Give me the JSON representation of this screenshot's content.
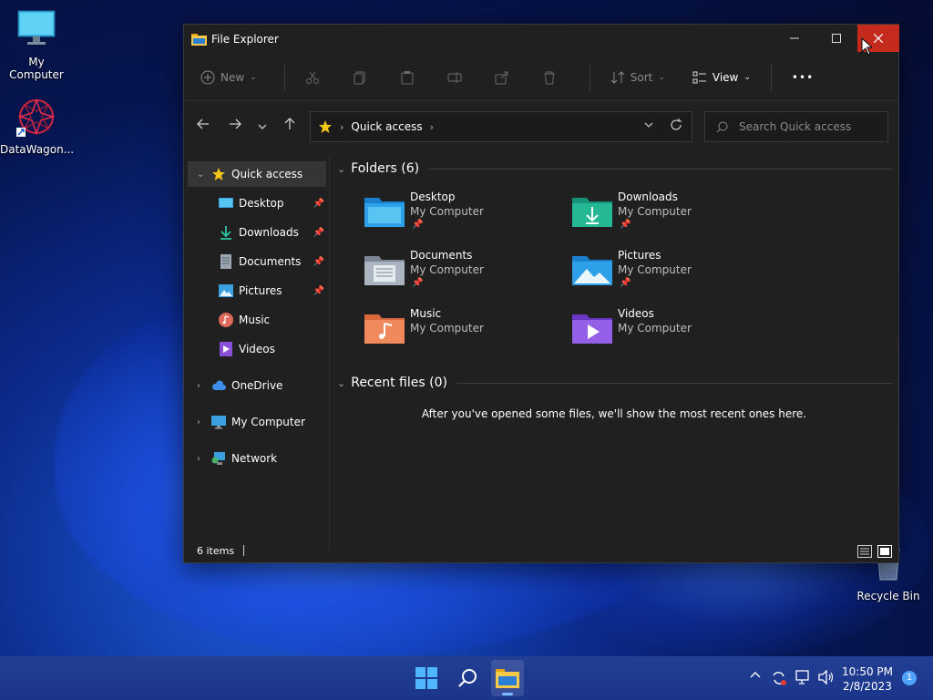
{
  "desktop": {
    "icons": [
      {
        "label": "My Computer"
      },
      {
        "label": "DataWagon..."
      },
      {
        "label": "Recycle Bin"
      }
    ]
  },
  "window": {
    "title": "File Explorer",
    "toolbar": {
      "new_label": "New",
      "sort_label": "Sort",
      "view_label": "View",
      "more_label": "•••"
    },
    "address": {
      "crumb": "Quick access",
      "search_placeholder": "Search Quick access"
    },
    "nav": {
      "quick_access": "Quick access",
      "items": [
        {
          "label": "Desktop",
          "pinned": true
        },
        {
          "label": "Downloads",
          "pinned": true
        },
        {
          "label": "Documents",
          "pinned": true
        },
        {
          "label": "Pictures",
          "pinned": true
        },
        {
          "label": "Music",
          "pinned": false
        },
        {
          "label": "Videos",
          "pinned": false
        }
      ],
      "onedrive": "OneDrive",
      "mycomputer": "My Computer",
      "network": "Network"
    },
    "content": {
      "folders_header": "Folders (6)",
      "folders": [
        {
          "name": "Desktop",
          "location": "My Computer",
          "pinned": true
        },
        {
          "name": "Downloads",
          "location": "My Computer",
          "pinned": true
        },
        {
          "name": "Documents",
          "location": "My Computer",
          "pinned": true
        },
        {
          "name": "Pictures",
          "location": "My Computer",
          "pinned": true
        },
        {
          "name": "Music",
          "location": "My Computer",
          "pinned": false
        },
        {
          "name": "Videos",
          "location": "My Computer",
          "pinned": false
        }
      ],
      "recent_header": "Recent files (0)",
      "recent_empty": "After you've opened some files, we'll show the most recent ones here."
    },
    "status": {
      "items_count": "6 items"
    }
  },
  "taskbar": {
    "time": "10:50 PM",
    "date": "2/8/2023",
    "notification_count": "1"
  },
  "colors": {
    "close_red": "#c42b1c",
    "window_bg": "#202020",
    "accent_blue": "#4fa3ff"
  }
}
